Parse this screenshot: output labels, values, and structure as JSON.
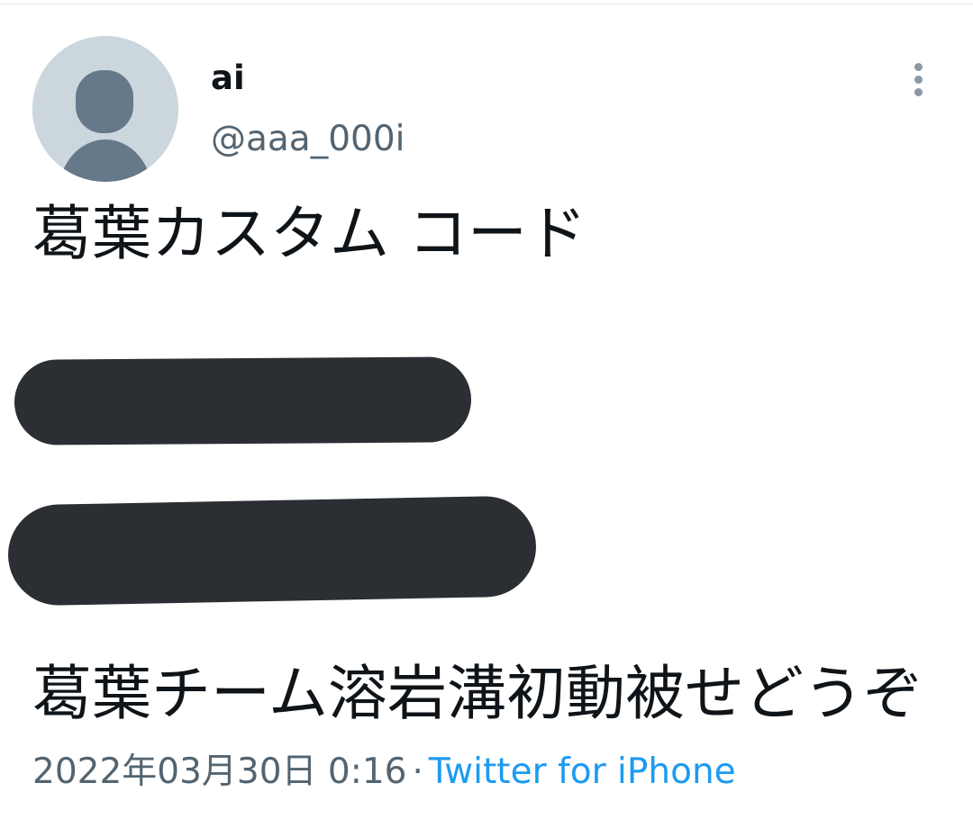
{
  "tweet": {
    "author": {
      "display_name": "ai",
      "handle": "@aaa_000i",
      "avatar_icon": "default-user-avatar-icon"
    },
    "more_icon": "vertical-dots-icon",
    "text_line_1": "葛葉カスタム コード",
    "text_line_2": "葛葉チーム溶岩溝初動被せどうぞ",
    "timestamp": "2022年03月30日 0:16",
    "separator": "·",
    "source": "Twitter for iPhone"
  },
  "colors": {
    "text_primary": "#0f1419",
    "text_secondary": "#536471",
    "link": "#1d9bf0",
    "avatar_bg": "#ccd6dd",
    "avatar_fg": "#66798a",
    "redaction": "#2b2f33"
  }
}
